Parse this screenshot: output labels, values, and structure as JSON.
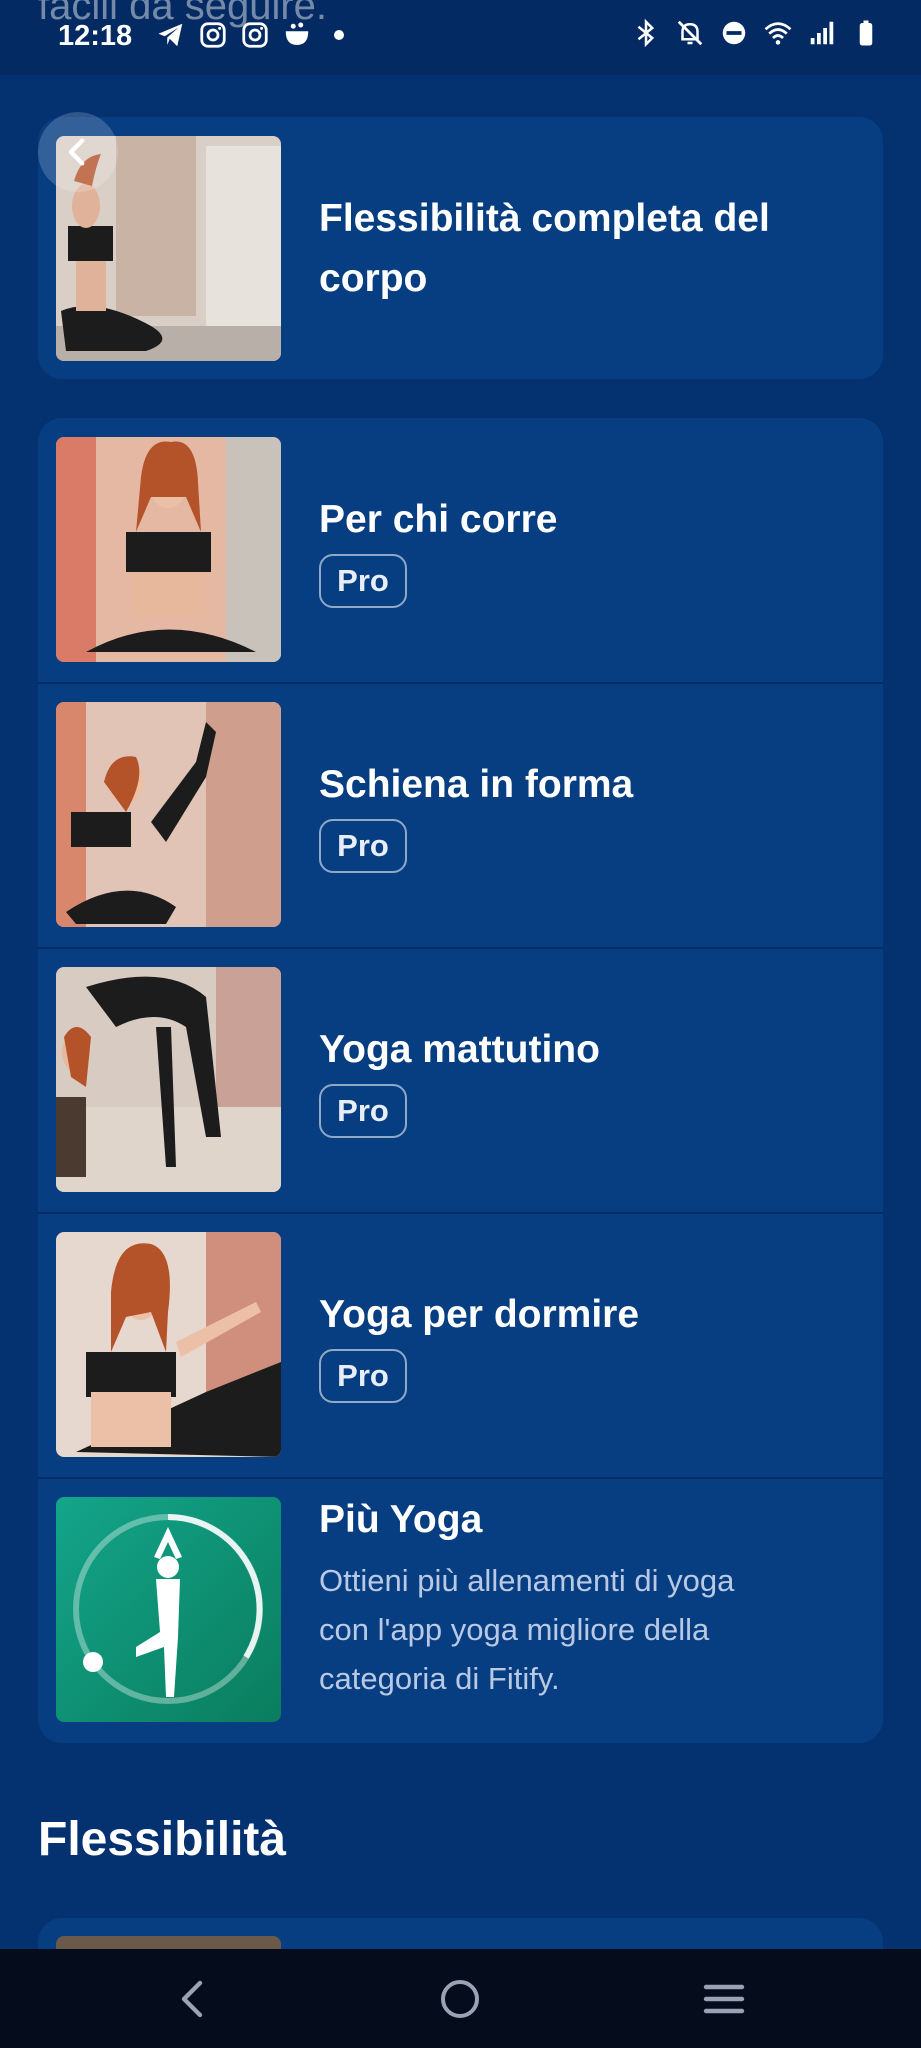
{
  "ghost_text": "facili da seguire.",
  "status_bar": {
    "time": "12:18",
    "left_icons": [
      "telegram-icon",
      "instagram-icon",
      "instagram-icon",
      "notification-icon",
      "dot-icon"
    ],
    "right_icons": [
      "bluetooth-icon",
      "mute-icon",
      "dnd-icon",
      "wifi-icon",
      "signal-icon",
      "battery-icon"
    ]
  },
  "featured": {
    "title_line1": "Flessibilità completa del",
    "title_line2": "corpo"
  },
  "workouts": [
    {
      "title": "Per chi corre",
      "badge": "Pro"
    },
    {
      "title": "Schiena in forma",
      "badge": "Pro"
    },
    {
      "title": "Yoga mattutino",
      "badge": "Pro"
    },
    {
      "title": "Yoga per dormire",
      "badge": "Pro"
    }
  ],
  "promo": {
    "title": "Più Yoga",
    "desc_line1": "Ottieni più allenamenti di yoga",
    "desc_line2": "con l'app yoga migliore della",
    "desc_line3": "categoria di Fitify."
  },
  "section": {
    "title": "Flessibilità"
  },
  "colors": {
    "background": "#043170",
    "card": "#073e82",
    "promo_teal": "#0f9a7c",
    "nav_bar": "#050c1c"
  }
}
